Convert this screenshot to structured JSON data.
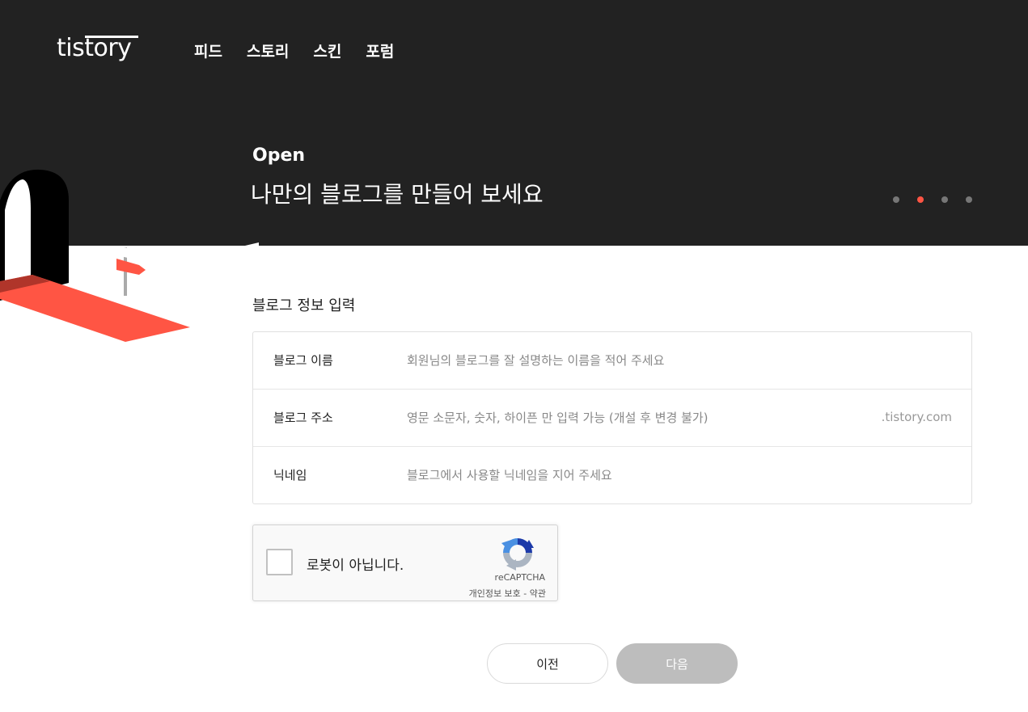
{
  "header": {
    "logo_text": "tistory",
    "nav": [
      "피드",
      "스토리",
      "스킨",
      "포럼"
    ],
    "kicker": "Open",
    "title": "나만의 블로그를 만들어 보세요",
    "carousel_dots": 4,
    "carousel_active_index": 1,
    "colors": {
      "background": "#222222",
      "accent": "#ff5544"
    }
  },
  "form": {
    "section_title": "블로그 정보 입력",
    "rows": [
      {
        "label": "블로그 이름",
        "placeholder": "회원님의 블로그를 잘 설명하는 이름을 적어 주세요",
        "value": "",
        "suffix": ""
      },
      {
        "label": "블로그 주소",
        "placeholder": "영문 소문자, 숫자, 하이픈 만 입력 가능 (개설 후 변경 불가)",
        "value": "",
        "suffix": ".tistory.com"
      },
      {
        "label": "닉네임",
        "placeholder": "블로그에서 사용할 닉네임을 지어 주세요",
        "value": "",
        "suffix": ""
      }
    ]
  },
  "captcha": {
    "label": "로봇이 아닙니다.",
    "brand": "reCAPTCHA",
    "links": "개인정보 보호 - 약관",
    "checked": false,
    "icon": "recaptcha-logo-icon"
  },
  "buttons": {
    "prev_label": "이전",
    "next_label": "다음",
    "next_enabled": false
  }
}
